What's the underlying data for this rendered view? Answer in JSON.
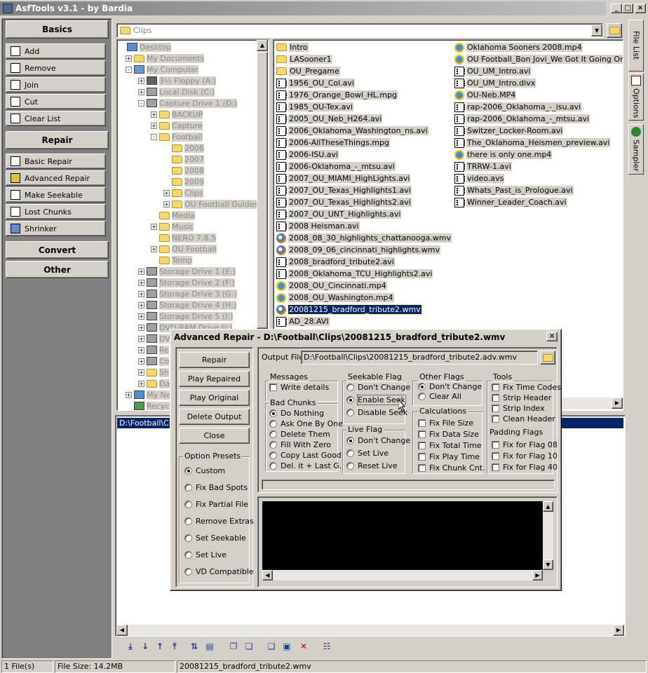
{
  "app": {
    "title": "AsfTools v3.1 - by Bardia"
  },
  "sidebar": {
    "basics_header": "Basics",
    "basics": [
      {
        "label": "Add",
        "icon": "add-icon"
      },
      {
        "label": "Remove",
        "icon": "remove-icon"
      },
      {
        "label": "Join",
        "icon": "join-icon"
      },
      {
        "label": "Cut",
        "icon": "cut-icon"
      },
      {
        "label": "Clear List",
        "icon": "clear-list-icon"
      }
    ],
    "repair_header": "Repair",
    "repair": [
      {
        "label": "Basic Repair",
        "icon": "basic-repair-icon"
      },
      {
        "label": "Advanced Repair",
        "icon": "advanced-repair-icon"
      },
      {
        "label": "Make Seekable",
        "icon": "make-seekable-icon"
      },
      {
        "label": "Lost Chunks",
        "icon": "lost-chunks-icon"
      },
      {
        "label": "Shrinker",
        "icon": "shrinker-icon"
      }
    ],
    "convert_header": "Convert",
    "other_header": "Other"
  },
  "path_combo": {
    "value": "Clips"
  },
  "tree": [
    {
      "label": "Desktop"
    },
    {
      "label": "My Documents"
    },
    {
      "label": "My Computer"
    },
    {
      "label": "3½ Floppy (A:)"
    },
    {
      "label": "Local Disk (C:)"
    },
    {
      "label": "Capture Drive 1 (D:)"
    },
    {
      "label": "BACKUP"
    },
    {
      "label": "Capture"
    },
    {
      "label": "Football"
    },
    {
      "label": "2006"
    },
    {
      "label": "2007"
    },
    {
      "label": "2008"
    },
    {
      "label": "2009"
    },
    {
      "label": "Clips"
    },
    {
      "label": "OU Football Guides"
    },
    {
      "label": "Media"
    },
    {
      "label": "Music"
    },
    {
      "label": "NERO 7.8.5"
    },
    {
      "label": "OU Football"
    },
    {
      "label": "Temp"
    },
    {
      "label": "Storage Drive 1 (E:)"
    },
    {
      "label": "Storage Drive 2 (F:)"
    },
    {
      "label": "Storage Drive 3 (G:)"
    },
    {
      "label": "Storage Drive 4 (H:)"
    },
    {
      "label": "Storage Drive 5 (I:)"
    },
    {
      "label": "DVD-RAM Drive (J:)"
    },
    {
      "label": "DV"
    },
    {
      "label": "Re"
    },
    {
      "label": "Co"
    },
    {
      "label": "Sh"
    },
    {
      "label": "Da"
    },
    {
      "label": "My Ne"
    },
    {
      "label": "Recyc"
    }
  ],
  "files_col1": [
    {
      "name": "Intro",
      "type": "folder"
    },
    {
      "name": "LASooner1",
      "type": "folder"
    },
    {
      "name": "OU_Pregame",
      "type": "folder"
    },
    {
      "name": "1956_OU_Col.avi",
      "type": "film"
    },
    {
      "name": "1976_Orange_Bowl_HL.mpg",
      "type": "film"
    },
    {
      "name": "1985_OU-Tex.avi",
      "type": "film"
    },
    {
      "name": "2005_OU_Neb_H264.avi",
      "type": "film"
    },
    {
      "name": "2006_Oklahoma_Washington_ns.avi",
      "type": "film"
    },
    {
      "name": "2006-AllTheseThings.mpg",
      "type": "film"
    },
    {
      "name": "2006-ISU.avi",
      "type": "film"
    },
    {
      "name": "2006-Oklahoma_-_mtsu.avi",
      "type": "film"
    },
    {
      "name": "2007_OU_MIAMI_HighLights.avi",
      "type": "film"
    },
    {
      "name": "2007_OU_Texas_Highlights1.avi",
      "type": "film"
    },
    {
      "name": "2007_OU_Texas_Highlights2.avi",
      "type": "film"
    },
    {
      "name": "2007_OU_UNT_Highlights.avi",
      "type": "film"
    },
    {
      "name": "2008 Heisman.avi",
      "type": "film"
    },
    {
      "name": "2008_08_30_highlights_chattanooga.wmv",
      "type": "wmp"
    },
    {
      "name": "2008_09_06_cincinnati_highlights.wmv",
      "type": "wmp"
    },
    {
      "name": "2008_bradford_tribute2.avi",
      "type": "film"
    },
    {
      "name": "2008_Oklahoma_TCU_Highlights2.avi",
      "type": "film"
    },
    {
      "name": "2008_OU_Cincinnati.mp4",
      "type": "qt"
    },
    {
      "name": "2008_OU_Washington.mp4",
      "type": "qt"
    },
    {
      "name": "20081215_bradford_tribute2.wmv",
      "type": "wmp"
    },
    {
      "name": "AD_28.AVI",
      "type": "film"
    }
  ],
  "files_col2": [
    {
      "name": "Oklahoma Sooners 2008.mp4",
      "type": "qt"
    },
    {
      "name": "OU Football_Bon Jovi_We Got It Going On.mp",
      "type": "qt"
    },
    {
      "name": "OU_UM_Intro.avi",
      "type": "film"
    },
    {
      "name": "OU_UM_Intro.divx",
      "type": "film"
    },
    {
      "name": "OU-Neb.MP4",
      "type": "qt"
    },
    {
      "name": "rap-2006_Oklahoma_-_isu.avi",
      "type": "film"
    },
    {
      "name": "rap-2006_Oklahoma_-_mtsu.avi",
      "type": "film"
    },
    {
      "name": "Switzer_Locker-Room.avi",
      "type": "film"
    },
    {
      "name": "The_Oklahoma_Heismen_preview.avi",
      "type": "film"
    },
    {
      "name": "there is only one.mp4",
      "type": "qt"
    },
    {
      "name": "TRRW-1.avi",
      "type": "film"
    },
    {
      "name": "video.avs",
      "type": "film"
    },
    {
      "name": "Whats_Past_is_Prologue.avi",
      "type": "film"
    },
    {
      "name": "Winner_Leader_Coach.avi",
      "type": "film"
    }
  ],
  "selected_file": "20081215_bradford_tribute2.wmv",
  "list_panel": {
    "row": "D:\\Football\\Clip"
  },
  "right_tabs": [
    "File List",
    "Options",
    "Sampler"
  ],
  "dialog": {
    "title": "Advanced Repair - D:\\Football\\Clips\\20081215_bradford_tribute2.wmv",
    "buttons": [
      "Repair",
      "Play Repaired",
      "Play Original",
      "Delete Output",
      "Close"
    ],
    "output_label": "Output File:",
    "output_value": "D:\\Football\\Clips\\20081215_bradford_tribute2.adv.wmv",
    "presets_title": "Option Presets",
    "presets": [
      "Custom",
      "Fix Bad Spots",
      "Fix Partial File",
      "Remove Extras",
      "Set Seekable",
      "Set Live",
      "VD Compatible"
    ],
    "presets_selected": "Custom",
    "messages_title": "Messages",
    "messages_opt": "Write details",
    "bad_chunks_title": "Bad Chunks",
    "bad_chunks": [
      "Do Nothing",
      "Ask One By One",
      "Delete Them",
      "Fill With Zero",
      "Copy Last Good",
      "Del. it + Last G."
    ],
    "bad_chunks_selected": "Do Nothing",
    "seekable_title": "Seekable Flag",
    "seekable": [
      "Don't Change",
      "Enable Seek",
      "Disable Seek"
    ],
    "seekable_selected": "Enable Seek",
    "live_title": "Live Flag",
    "live": [
      "Don't Change",
      "Set Live",
      "Reset Live"
    ],
    "live_selected": "Don't Change",
    "other_title": "Other Flags",
    "other": [
      "Don't Change",
      "Clear All"
    ],
    "other_selected": "Don't Change",
    "calc_title": "Calculations",
    "calc": [
      "Fix File Size",
      "Fix Data Size",
      "Fix Total Time",
      "Fix Play Time",
      "Fix Chunk Cnt."
    ],
    "tools_title": "Tools",
    "tools": [
      "Fix Time Codes",
      "Strip Header",
      "Strip Index",
      "Clean Header"
    ],
    "padding_title": "Padding Flags",
    "padding": [
      "Fix for Flag 08",
      "Fix for Flag 10",
      "Fix for Flag 40"
    ]
  },
  "status": {
    "count": "1 File(s)",
    "size": "File Size: 14.2MB",
    "file": "20081215_bradford_tribute2.wmv"
  },
  "colors": {
    "selection": "#0a246a",
    "title_bg": "#808080",
    "console_bg": "#000000"
  }
}
